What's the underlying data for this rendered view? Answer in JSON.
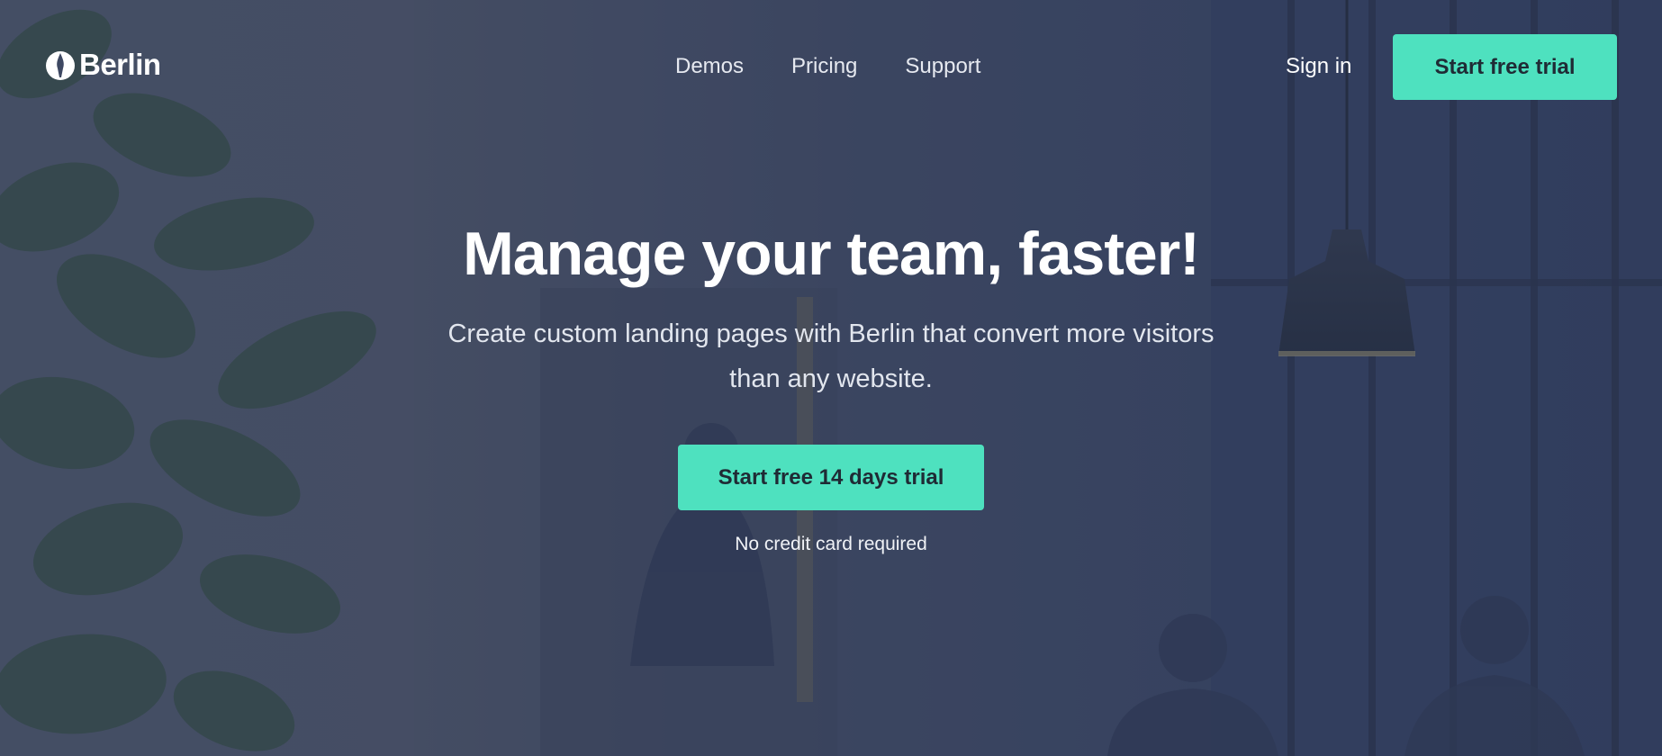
{
  "brand": {
    "name": "Berlin",
    "logo_icon": "flame-drop-icon"
  },
  "nav": {
    "links": [
      {
        "label": "Demos"
      },
      {
        "label": "Pricing"
      },
      {
        "label": "Support"
      }
    ],
    "sign_in": "Sign in",
    "cta": "Start free trial"
  },
  "hero": {
    "title": "Manage your team, faster!",
    "subtitle": "Create custom landing pages with Berlin that convert more visitors than any website.",
    "cta": "Start free 14 days trial",
    "note": "No credit card required"
  },
  "colors": {
    "accent": "#4ee1bf",
    "overlay": "#36425f",
    "text_dark": "#1f2b35"
  }
}
